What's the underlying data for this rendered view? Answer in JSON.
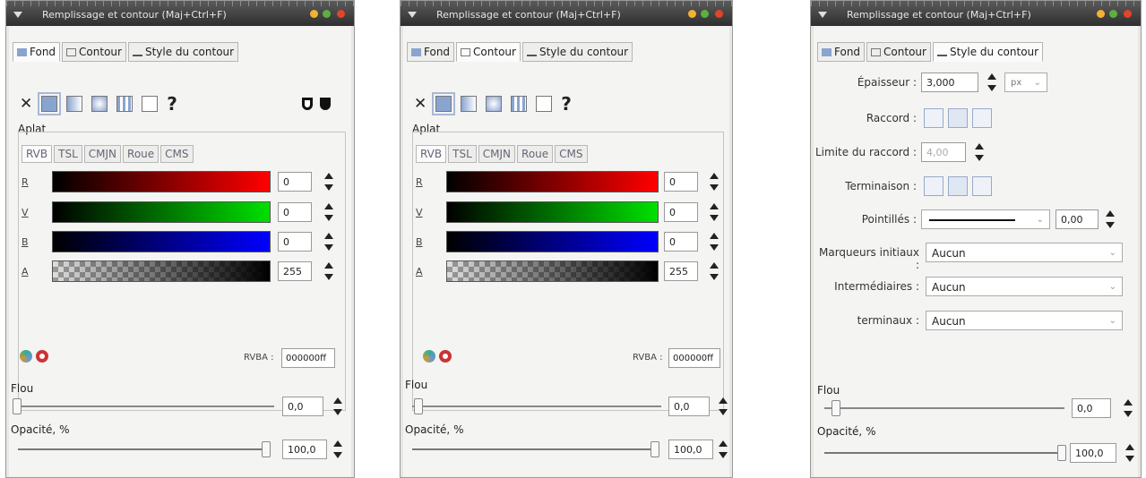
{
  "dialogs": [
    {
      "title": "Remplissage et contour (Maj+Ctrl+F)",
      "tabs": [
        "Fond",
        "Contour",
        "Style du contour"
      ],
      "active_tab": 0,
      "flat_label": "Aplat",
      "color_tabs": [
        "RVB",
        "TSL",
        "CMJN",
        "Roue",
        "CMS"
      ],
      "channels": [
        {
          "label": "R",
          "value": "0"
        },
        {
          "label": "V",
          "value": "0"
        },
        {
          "label": "B",
          "value": "0"
        },
        {
          "label": "A",
          "value": "255"
        }
      ],
      "rgba_label": "RVBA :",
      "rgba_value": "000000ff",
      "blur_label": "Flou",
      "blur_value": "0,0",
      "opacity_label": "Opacité, %",
      "opacity_value": "100,0"
    },
    {
      "title": "Remplissage et contour (Maj+Ctrl+F)",
      "tabs": [
        "Fond",
        "Contour",
        "Style du contour"
      ],
      "active_tab": 1,
      "flat_label": "Aplat",
      "color_tabs": [
        "RVB",
        "TSL",
        "CMJN",
        "Roue",
        "CMS"
      ],
      "channels": [
        {
          "label": "R",
          "value": "0"
        },
        {
          "label": "V",
          "value": "0"
        },
        {
          "label": "B",
          "value": "0"
        },
        {
          "label": "A",
          "value": "255"
        }
      ],
      "rgba_label": "RVBA :",
      "rgba_value": "000000ff",
      "blur_label": "Flou",
      "blur_value": "0,0",
      "opacity_label": "Opacité, %",
      "opacity_value": "100,0"
    },
    {
      "title": "Remplissage et contour (Maj+Ctrl+F)",
      "tabs": [
        "Fond",
        "Contour",
        "Style du contour"
      ],
      "active_tab": 2,
      "width_label": "Épaisseur :",
      "width_value": "3,000",
      "unit": "px",
      "join_label": "Raccord :",
      "miter_label": "Limite du raccord :",
      "miter_value": "4,00",
      "cap_label": "Terminaison :",
      "dash_label": "Pointillés :",
      "dash_offset": "0,00",
      "start_markers_label": "Marqueurs initiaux :",
      "start_markers_value": "Aucun",
      "mid_markers_label": "Intermédiaires :",
      "mid_markers_value": "Aucun",
      "end_markers_label": "terminaux :",
      "end_markers_value": "Aucun",
      "blur_label": "Flou",
      "blur_value": "0,0",
      "opacity_label": "Opacité, %",
      "opacity_value": "100,0"
    }
  ],
  "colors": {
    "titlebar": "#3a3a3a",
    "close_button": "#e0452a",
    "min_button": "#f3b233",
    "max_button": "#5cb042",
    "red_channel": "#ff0000",
    "green_channel": "#00e000",
    "blue_channel": "#0000ff"
  },
  "icons": [
    "window-menu-icon",
    "remove-paint-icon",
    "flat-color-icon",
    "linear-gradient-icon",
    "radial-gradient-icon",
    "pattern-icon",
    "swatch-icon",
    "unset-paint-icon",
    "fill-rule-evenodd-icon",
    "fill-rule-nonzero-icon",
    "color-picker-icon",
    "color-managed-icon",
    "miter-join-icon",
    "round-join-icon",
    "bevel-join-icon",
    "butt-cap-icon",
    "round-cap-icon",
    "square-cap-icon"
  ]
}
